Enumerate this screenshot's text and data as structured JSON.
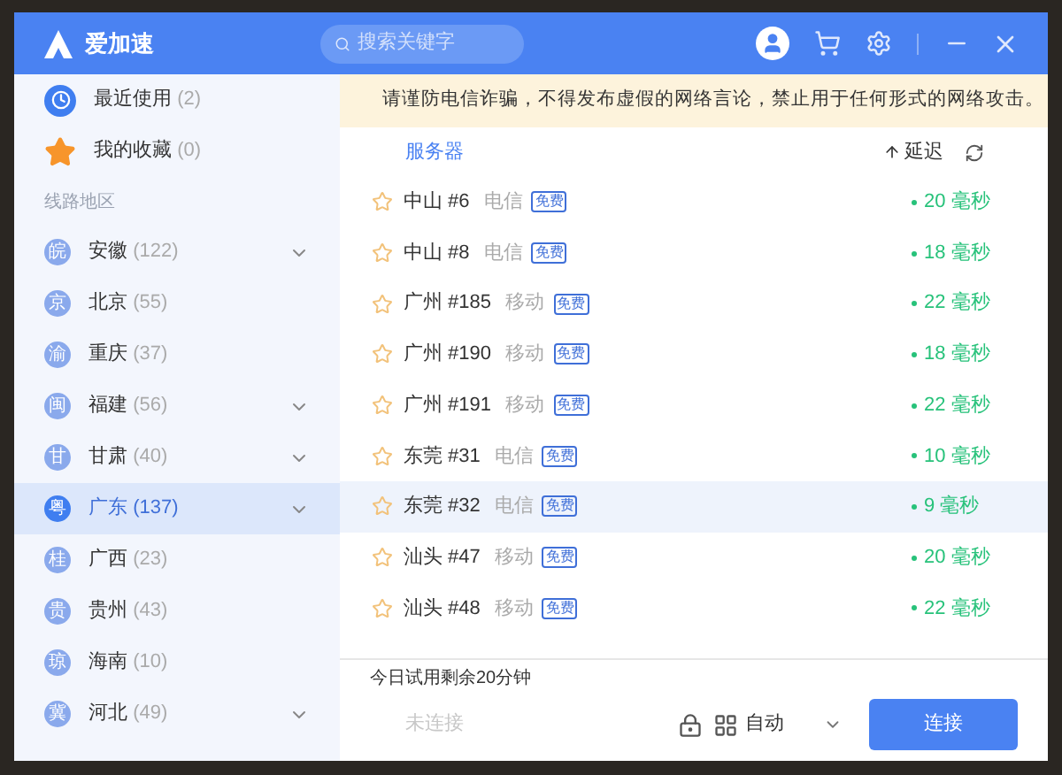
{
  "app": {
    "name": "爱加速"
  },
  "search": {
    "placeholder": "搜索关键字"
  },
  "sidebar": {
    "quick": [
      {
        "kind": "recent",
        "label": "最近使用",
        "count": "(2)"
      },
      {
        "kind": "favorite",
        "label": "我的收藏",
        "count": "(0)"
      }
    ],
    "section_label": "线路地区",
    "regions": [
      {
        "abbr": "皖",
        "name": "安徽",
        "count": "(122)",
        "expandable": true,
        "selected": false
      },
      {
        "abbr": "京",
        "name": "北京",
        "count": "(55)",
        "expandable": false,
        "selected": false
      },
      {
        "abbr": "渝",
        "name": "重庆",
        "count": "(37)",
        "expandable": false,
        "selected": false
      },
      {
        "abbr": "闽",
        "name": "福建",
        "count": "(56)",
        "expandable": true,
        "selected": false
      },
      {
        "abbr": "甘",
        "name": "甘肃",
        "count": "(40)",
        "expandable": true,
        "selected": false
      },
      {
        "abbr": "粤",
        "name": "广东",
        "count": "(137)",
        "expandable": true,
        "selected": true
      },
      {
        "abbr": "桂",
        "name": "广西",
        "count": "(23)",
        "expandable": false,
        "selected": false
      },
      {
        "abbr": "贵",
        "name": "贵州",
        "count": "(43)",
        "expandable": false,
        "selected": false
      },
      {
        "abbr": "琼",
        "name": "海南",
        "count": "(10)",
        "expandable": false,
        "selected": false
      },
      {
        "abbr": "冀",
        "name": "河北",
        "count": "(49)",
        "expandable": true,
        "selected": false
      }
    ]
  },
  "notice": {
    "text": "请谨防电信诈骗，不得发布虚假的网络言论，禁止用于任何形式的网络攻击。"
  },
  "table": {
    "columns": [
      "服务器",
      "延迟"
    ],
    "rows": [
      {
        "name": "中山 #6",
        "isp": "电信",
        "tag": "免费",
        "latency": "20 毫秒",
        "favorite": false,
        "selected": false
      },
      {
        "name": "中山 #8",
        "isp": "电信",
        "tag": "免费",
        "latency": "18 毫秒",
        "favorite": false,
        "selected": false
      },
      {
        "name": "广州 #185",
        "isp": "移动",
        "tag": "免费",
        "latency": "22 毫秒",
        "favorite": false,
        "selected": false
      },
      {
        "name": "广州 #190",
        "isp": "移动",
        "tag": "免费",
        "latency": "18 毫秒",
        "favorite": false,
        "selected": false
      },
      {
        "name": "广州 #191",
        "isp": "移动",
        "tag": "免费",
        "latency": "22 毫秒",
        "favorite": false,
        "selected": false
      },
      {
        "name": "东莞 #31",
        "isp": "电信",
        "tag": "免费",
        "latency": "10 毫秒",
        "favorite": false,
        "selected": false
      },
      {
        "name": "东莞 #32",
        "isp": "电信",
        "tag": "免费",
        "latency": "9 毫秒",
        "favorite": false,
        "selected": true
      },
      {
        "name": "汕头 #47",
        "isp": "移动",
        "tag": "免费",
        "latency": "20 毫秒",
        "favorite": false,
        "selected": false
      },
      {
        "name": "汕头 #48",
        "isp": "移动",
        "tag": "免费",
        "latency": "22 毫秒",
        "favorite": false,
        "selected": false
      }
    ]
  },
  "footer": {
    "trial": "今日试用剩余20分钟",
    "status": "未连接",
    "mode": "自动",
    "connect": "连接"
  }
}
